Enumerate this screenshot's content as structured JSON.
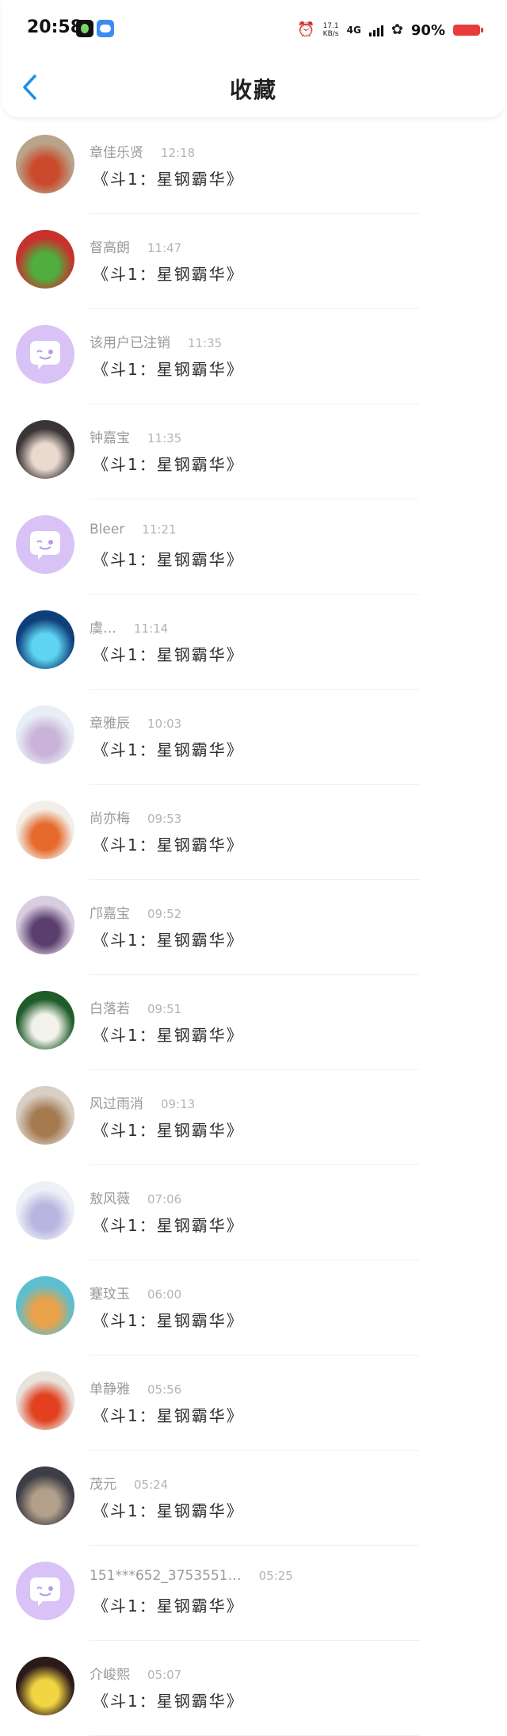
{
  "status_bar": {
    "time": "20:58",
    "net_speed_value": "17.1",
    "net_speed_unit": "KB/s",
    "network": "4G",
    "battery": "90%"
  },
  "header": {
    "title": "收藏",
    "back_icon": "chevron-left-icon",
    "accent_color": "#1e90e6"
  },
  "message_preview": "《斗1：星钢霸华》",
  "items": [
    {
      "name": "章佳乐贤",
      "time": "12:18",
      "message": "《斗1：星钢霸华》",
      "avatar": {
        "bg": "#b9a48b",
        "fg": "#c94a2c"
      }
    },
    {
      "name": "督高朗",
      "time": "11:47",
      "message": "《斗1：星钢霸华》",
      "avatar": {
        "bg": "#c7322d",
        "fg": "#4fae3e"
      }
    },
    {
      "name": "该用户已注销",
      "time": "11:35",
      "message": "《斗1：星钢霸华》",
      "avatar": {
        "default": true
      }
    },
    {
      "name": "钟嘉宝",
      "time": "11:35",
      "message": "《斗1：星钢霸华》",
      "avatar": {
        "bg": "#3a3535",
        "fg": "#e9d9cf"
      }
    },
    {
      "name": "Bleer",
      "time": "11:21",
      "message": "《斗1：星钢霸华》",
      "avatar": {
        "default": true
      }
    },
    {
      "name": "虞…",
      "time": "11:14",
      "message": "《斗1：星钢霸华》",
      "avatar": {
        "bg": "#0f3f7a",
        "fg": "#5ed4f2"
      }
    },
    {
      "name": "章雅辰",
      "time": "10:03",
      "message": "《斗1：星钢霸华》",
      "avatar": {
        "bg": "#e8eef5",
        "fg": "#c9b3d8"
      }
    },
    {
      "name": "尚亦梅",
      "time": "09:53",
      "message": "《斗1：星钢霸华》",
      "avatar": {
        "bg": "#f3efe8",
        "fg": "#e56a2c"
      }
    },
    {
      "name": "邝嘉宝",
      "time": "09:52",
      "message": "《斗1：星钢霸华》",
      "avatar": {
        "bg": "#d9cde0",
        "fg": "#5a3f6e"
      }
    },
    {
      "name": "白落若",
      "time": "09:51",
      "message": "《斗1：星钢霸华》",
      "avatar": {
        "bg": "#1f5c2a",
        "fg": "#f2f2ea"
      }
    },
    {
      "name": "风过雨消",
      "time": "09:13",
      "message": "《斗1：星钢霸华》",
      "avatar": {
        "bg": "#d8cfc5",
        "fg": "#a47a4f"
      }
    },
    {
      "name": "敖风薇",
      "time": "07:06",
      "message": "《斗1：星钢霸华》",
      "avatar": {
        "bg": "#eef0f8",
        "fg": "#b8b6e0"
      }
    },
    {
      "name": "蹇玟玉",
      "time": "06:00",
      "message": "《斗1：星钢霸华》",
      "avatar": {
        "bg": "#5bbfd0",
        "fg": "#e8a24a"
      }
    },
    {
      "name": "单静雅",
      "time": "05:56",
      "message": "《斗1：星钢霸华》",
      "avatar": {
        "bg": "#e8e2dc",
        "fg": "#e2401f"
      }
    },
    {
      "name": "茂元",
      "time": "05:24",
      "message": "《斗1：星钢霸华》",
      "avatar": {
        "bg": "#3d3d47",
        "fg": "#b2a08a"
      }
    },
    {
      "name": "151***652_3753551…",
      "time": "05:25",
      "message": "《斗1：星钢霸华》",
      "avatar": {
        "default": true
      }
    },
    {
      "name": "介峻熙",
      "time": "05:07",
      "message": "《斗1：星钢霸华》",
      "avatar": {
        "bg": "#2b1a1a",
        "fg": "#f2d542"
      }
    }
  ]
}
